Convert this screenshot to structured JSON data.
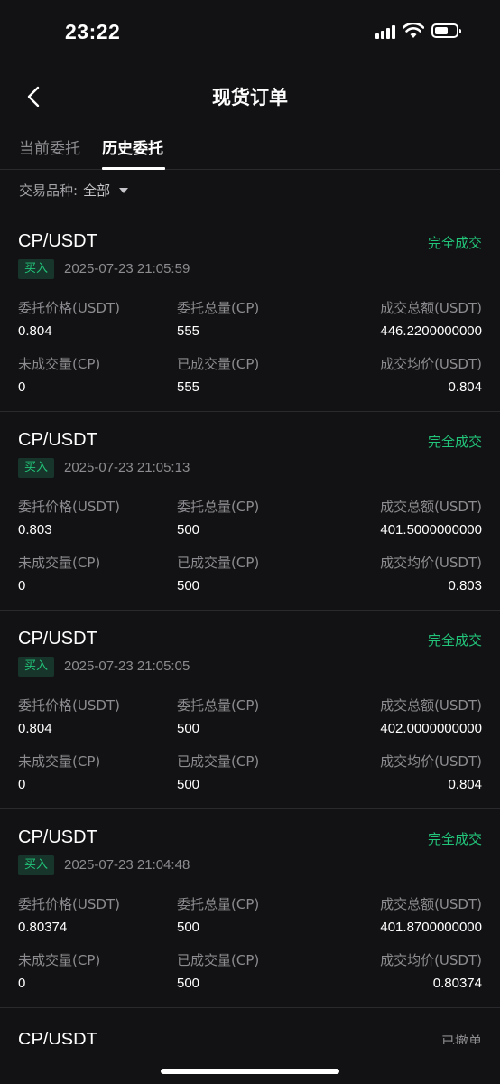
{
  "status_bar": {
    "time": "23:22"
  },
  "header": {
    "title": "现货订单",
    "back_icon": "chevron-left-icon"
  },
  "tabs": [
    {
      "label": "当前委托",
      "active": false
    },
    {
      "label": "历史委托",
      "active": true
    }
  ],
  "filter": {
    "label": "交易品种:",
    "value": "全部"
  },
  "labels": {
    "order_price": "委托价格(USDT)",
    "order_total": "委托总量(CP)",
    "filled_amount": "成交总额(USDT)",
    "unfilled_qty": "未成交量(CP)",
    "filled_qty": "已成交量(CP)",
    "avg_price": "成交均价(USDT)"
  },
  "orders": [
    {
      "pair": "CP/USDT",
      "status": "完全成交",
      "side": "买入",
      "time": "2025-07-23 21:05:59",
      "order_price": "0.804",
      "order_total": "555",
      "filled_amount": "446.2200000000",
      "unfilled_qty": "0",
      "filled_qty": "555",
      "avg_price": "0.804"
    },
    {
      "pair": "CP/USDT",
      "status": "完全成交",
      "side": "买入",
      "time": "2025-07-23 21:05:13",
      "order_price": "0.803",
      "order_total": "500",
      "filled_amount": "401.5000000000",
      "unfilled_qty": "0",
      "filled_qty": "500",
      "avg_price": "0.803"
    },
    {
      "pair": "CP/USDT",
      "status": "完全成交",
      "side": "买入",
      "time": "2025-07-23 21:05:05",
      "order_price": "0.804",
      "order_total": "500",
      "filled_amount": "402.0000000000",
      "unfilled_qty": "0",
      "filled_qty": "500",
      "avg_price": "0.804"
    },
    {
      "pair": "CP/USDT",
      "status": "完全成交",
      "side": "买入",
      "time": "2025-07-23 21:04:48",
      "order_price": "0.80374",
      "order_total": "500",
      "filled_amount": "401.8700000000",
      "unfilled_qty": "0",
      "filled_qty": "500",
      "avg_price": "0.80374"
    }
  ],
  "partial_order": {
    "pair": "CP/USDT",
    "status": "已撤单"
  },
  "colors": {
    "background": "#121214",
    "filled_status": "#22c47a",
    "buy_badge_bg": "#17352a",
    "muted_text": "#8c8c90"
  }
}
